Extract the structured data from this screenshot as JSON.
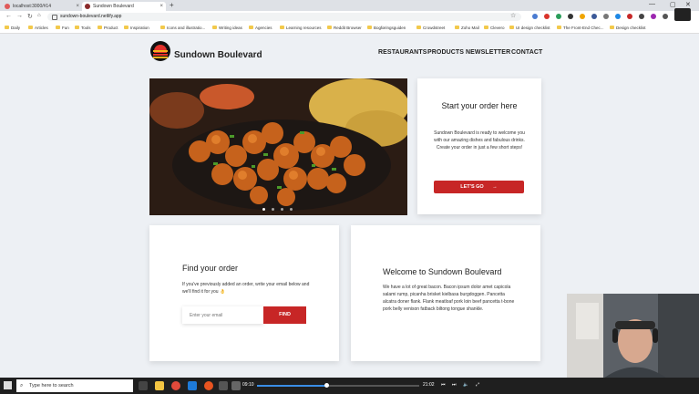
{
  "browser": {
    "tabs": [
      {
        "title": "localhost:3000/#14",
        "favicon_color": "#e05a5a"
      },
      {
        "title": "Sundown Boulevard",
        "favicon_color": "#8a2b2b"
      }
    ],
    "url": "sundown-boulevard.netlify.app",
    "bookmarks": [
      "Daily",
      "Articles",
      "Fun",
      "Tools",
      "Product",
      "Inspiration",
      "Icons and illustratio...",
      "Writing ideas",
      "Agencies",
      "Learning resources",
      "Reddit Browser",
      "Bogføringsguiden",
      "Crowdstreet",
      "Zoho Mail",
      "Clevero",
      "UI design checklist",
      "The Front-End Chec...",
      "Design checklist"
    ]
  },
  "site": {
    "name": "Sundown Boulevard",
    "nav": [
      "RESTAURANTS",
      "PRODUCTS",
      "NEWSLETTER",
      "CONTACT"
    ],
    "order_card": {
      "title": "Start your order here",
      "text": "Sundown Boulevard is ready to welcome you with our amazing dishes and fabulous drinks. Create your order in just a few short steps!",
      "button": "LET'S GO",
      "arrow": "→"
    },
    "find_card": {
      "title": "Find your order",
      "text": "If you've previously added an order, write your email below and we'll find it for you 👌",
      "placeholder": "Enter your email",
      "button": "FIND"
    },
    "welcome_card": {
      "title": "Welcome to Sundown Boulevard",
      "text": "We have a lot of great bacon. Bacon ipsum dolor amet capicola salami rump, picanha brisket kielbasa burgdoggen. Pancetta alcatra doner flank. Flank meatloaf pork loin beef pancetta t-bone pork belly venison fatback biltong tongue shankle."
    }
  },
  "taskbar": {
    "search_placeholder": "Type here to search",
    "time_elapsed": "09:10",
    "time_total": "21:02"
  },
  "colors": {
    "accent": "#c72626",
    "page_bg": "#edf0f4"
  }
}
